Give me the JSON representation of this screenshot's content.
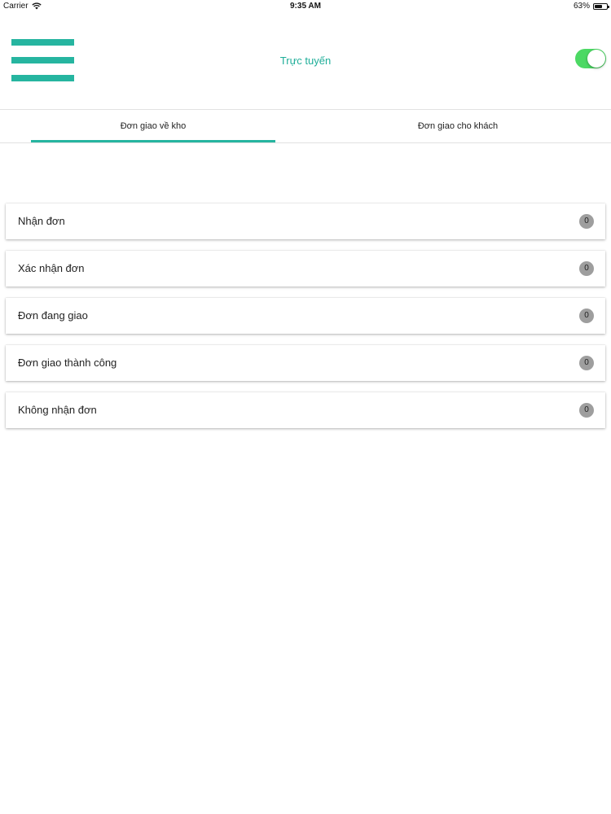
{
  "status_bar": {
    "carrier": "Carrier",
    "time": "9:35 AM",
    "battery": "63%",
    "battery_level": 0.63,
    "wifi_icon": "wifi-icon",
    "battery_icon": "battery-icon"
  },
  "header": {
    "menu_icon": "hamburger-menu-icon",
    "title": "Trực tuyến",
    "online_toggle": true,
    "accent_color": "#26b5a0",
    "toggle_color": "#4cd964"
  },
  "tabs": [
    {
      "label": "Đơn giao về kho",
      "active": true
    },
    {
      "label": "Đơn giao cho khách",
      "active": false
    }
  ],
  "order_list": [
    {
      "label": "Nhận đơn",
      "count": "0"
    },
    {
      "label": "Xác nhận đơn",
      "count": "0"
    },
    {
      "label": "Đơn đang giao",
      "count": "0"
    },
    {
      "label": "Đơn giao thành công",
      "count": "0"
    },
    {
      "label": "Không nhận đơn",
      "count": "0"
    }
  ]
}
